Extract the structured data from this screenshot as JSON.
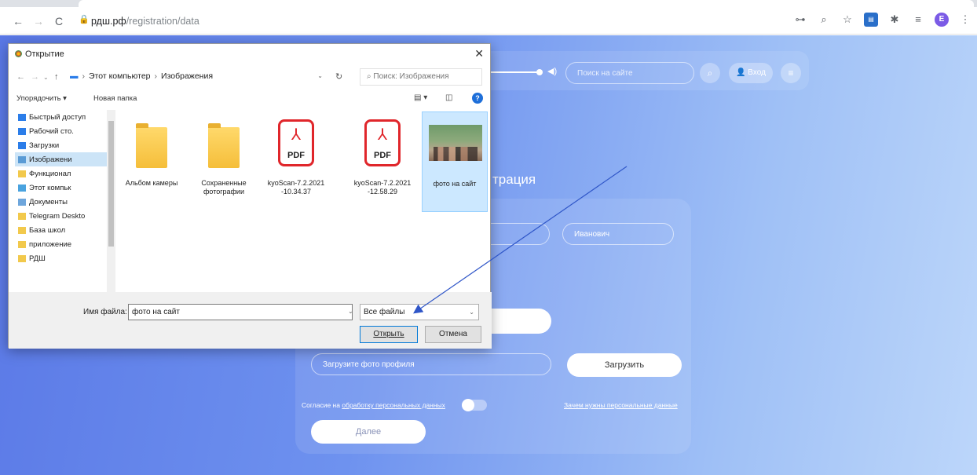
{
  "browser": {
    "url_domain": "рдш.рф",
    "url_path": "/registration/data",
    "back_icon": "←",
    "forward_icon": "→",
    "reload_icon": "C",
    "extensions": [
      "key-icon",
      "zoom-icon",
      "star-icon",
      "extension-icon",
      "puzzle-icon",
      "reading-list-icon",
      "profile-icon"
    ],
    "profile_letter": "E"
  },
  "site": {
    "search_placeholder": "Поиск на сайте",
    "login_label": "Вход",
    "title_fragment": "трация",
    "patronymic_value": "Иванович",
    "upload_placeholder": "Загрузите фото профиля",
    "upload_button": "Загрузить",
    "consent_prefix": "Согласие на ",
    "consent_link": "обработку персональных данных",
    "why_link": "Зачем нужны персональные данные",
    "next_button": "Далее"
  },
  "dialog": {
    "title": "Открытие",
    "address": [
      "Этот компьютер",
      "Изображения"
    ],
    "search_placeholder": "Поиск: Изображения",
    "organize_label": "Упорядочить ▾",
    "new_folder_label": "Новая папка",
    "sidebar": [
      {
        "label": "Быстрый доступ",
        "icon": "star-icon",
        "color": "#2b7de9"
      },
      {
        "label": "Рабочий сто.",
        "icon": "desktop-icon",
        "color": "#2b7de9"
      },
      {
        "label": "Загрузки",
        "icon": "download-icon",
        "color": "#2b7de9"
      },
      {
        "label": "Изображени",
        "icon": "pictures-icon",
        "color": "#5a9bd5",
        "selected": true
      },
      {
        "label": "Функционал",
        "icon": "folder-icon",
        "color": "#f2c94c"
      },
      {
        "label": "Этот компьк",
        "icon": "computer-icon",
        "color": "#4aa3df"
      },
      {
        "label": "Документы",
        "icon": "documents-icon",
        "color": "#6ea6dc"
      },
      {
        "label": "Telegram Deskto",
        "icon": "folder-icon",
        "color": "#f2c94c"
      },
      {
        "label": "База школ",
        "icon": "folder-icon",
        "color": "#f2c94c"
      },
      {
        "label": "приложение",
        "icon": "folder-icon",
        "color": "#f2c94c"
      },
      {
        "label": "РДШ",
        "icon": "folder-icon",
        "color": "#f2c94c"
      }
    ],
    "files": [
      {
        "name": "Альбом камеры",
        "type": "folder"
      },
      {
        "name": "Сохраненные фотографии",
        "type": "folder"
      },
      {
        "name": "kyoScan-7.2.2021 -10.34.37",
        "type": "pdf"
      },
      {
        "name": "kyoScan-7.2.2021 -12.58.29",
        "type": "pdf"
      },
      {
        "name": "фото на сайт",
        "type": "image",
        "selected": true
      }
    ],
    "filename_label": "Имя файла:",
    "filename_value": "фото на сайт",
    "filetype_value": "Все файлы",
    "open_button": "Открыть",
    "cancel_button": "Отмена",
    "pdf_label": "PDF"
  }
}
